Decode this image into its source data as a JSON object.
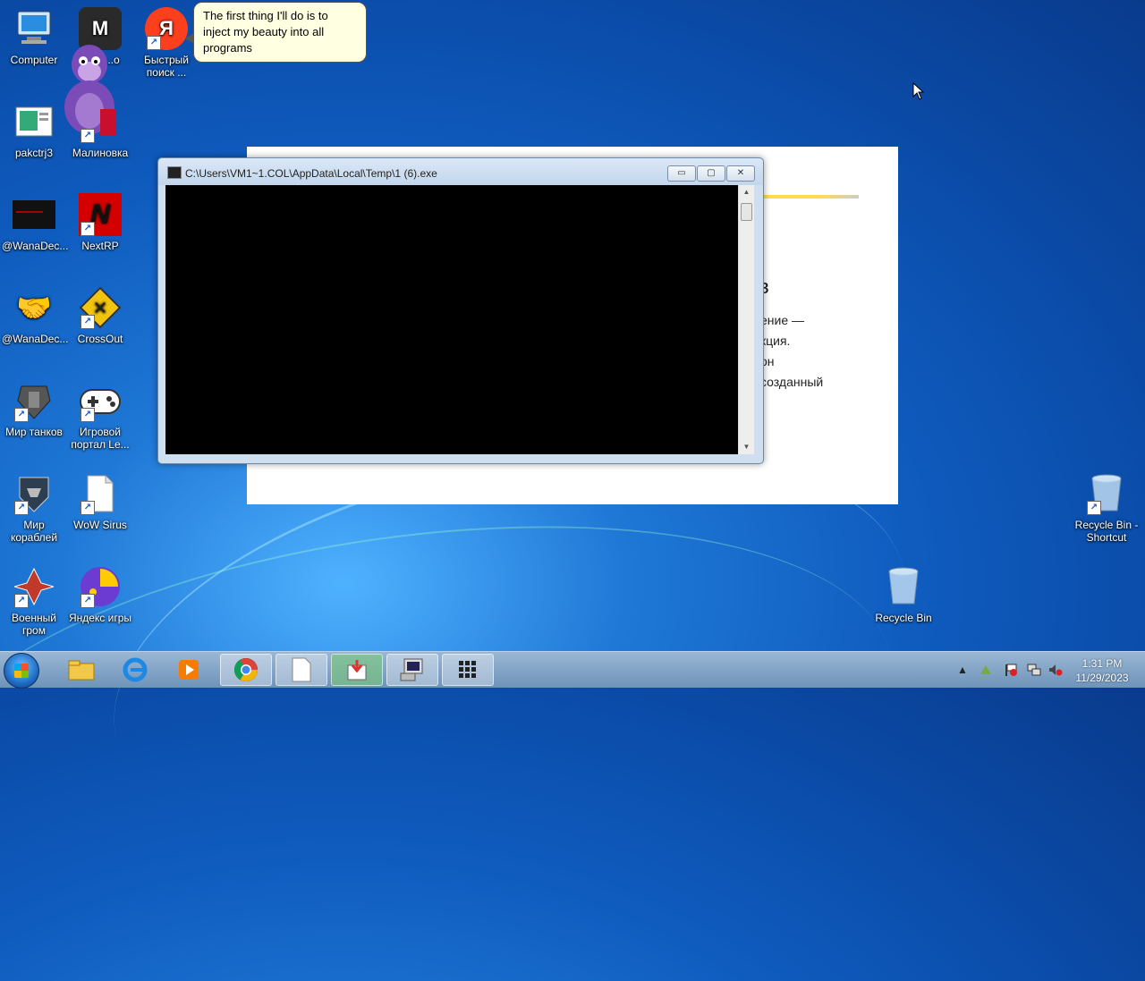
{
  "balloon": {
    "text": "The first thing I'll do is to inject my beauty into all programs"
  },
  "desktop_icons": [
    {
      "label": "Computer",
      "icon": "computer-icon"
    },
    {
      "label": "...ое ...о",
      "icon": "game-launcher-icon"
    },
    {
      "label": "Быстрый поиск ...",
      "icon": "yandex-icon"
    },
    {
      "label": "pakctrj3",
      "icon": "image-file-icon"
    },
    {
      "label": "Малиновка",
      "icon": "malinovka-icon"
    },
    {
      "label": "@WanaDec...",
      "icon": "wanadecryptor-icon"
    },
    {
      "label": "NextRP",
      "icon": "nextrp-icon"
    },
    {
      "label": "@WanaDec...",
      "icon": "handshake-icon"
    },
    {
      "label": "CrossOut",
      "icon": "crossout-icon"
    },
    {
      "label": "Мир танков",
      "icon": "tank-icon"
    },
    {
      "label": "Игровой портал Le...",
      "icon": "gamepad-icon"
    },
    {
      "label": "Мир кораблей",
      "icon": "ship-icon"
    },
    {
      "label": "WoW Sirus",
      "icon": "blank-file-icon"
    },
    {
      "label": "Военный гром",
      "icon": "warthunder-icon"
    },
    {
      "label": "Яндекс игры",
      "icon": "yandex-games-icon"
    },
    {
      "label": "Recycle Bin - Shortcut",
      "icon": "recycle-bin-icon"
    },
    {
      "label": "Recycle Bin",
      "icon": "recycle-bin-icon"
    }
  ],
  "background_window": {
    "heading_fragment": "в",
    "lines": [
      "ение —",
      "кция.",
      "он",
      "созданный"
    ]
  },
  "console": {
    "title": "C:\\Users\\VM1~1.COL\\AppData\\Local\\Temp\\1 (6).exe",
    "minimize": "▭",
    "maximize": "▢",
    "close": "✕"
  },
  "taskbar": {
    "clock_time": "1:31 PM",
    "clock_date": "11/29/2023",
    "tray_up_arrow": "▲"
  }
}
